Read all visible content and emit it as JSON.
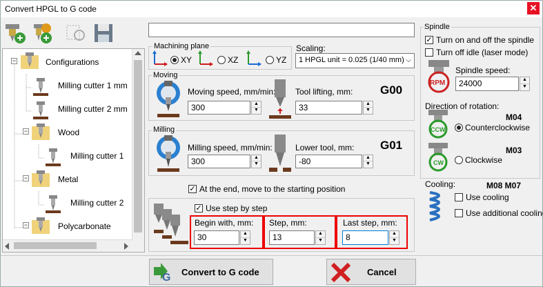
{
  "window": {
    "title": "Convert HPGL to G code",
    "close_glyph": "✕"
  },
  "toolbar": {
    "buttons": [
      "add-config-icon",
      "add-tool-icon",
      "copy-icon",
      "save-icon"
    ]
  },
  "tree": {
    "items": [
      {
        "label": "Configurations",
        "expander": "−"
      },
      {
        "label": "Milling cutter 1 mm"
      },
      {
        "label": "Milling cutter 2 mm"
      },
      {
        "label": "Wood",
        "expander": "−"
      },
      {
        "label": "Milling cutter 1"
      },
      {
        "label": "Metal",
        "expander": "−"
      },
      {
        "label": "Milling cutter 2"
      },
      {
        "label": "Polycarbonate",
        "expander": "−"
      }
    ]
  },
  "name_field": {
    "value": ""
  },
  "machining_plane": {
    "label": "Machining plane",
    "options": [
      {
        "label": "XY",
        "checked": true
      },
      {
        "label": "XZ",
        "checked": false
      },
      {
        "label": "YZ",
        "checked": false
      }
    ]
  },
  "scaling": {
    "label": "Scaling:",
    "value": "1 HPGL unit = 0.025 (1/40 mm)"
  },
  "moving": {
    "group_label": "Moving",
    "speed_label": "Moving speed, mm/min:",
    "speed_value": "300",
    "lift_label": "Tool lifting, mm:",
    "lift_value": "33",
    "code": "G00"
  },
  "milling": {
    "group_label": "Milling",
    "speed_label": "Milling speed, mm/min:",
    "speed_value": "300",
    "lower_label": "Lower tool, mm:",
    "lower_value": "-80",
    "code": "G01"
  },
  "return_start": {
    "label": "At the end, move to the starting position",
    "checked": true
  },
  "step": {
    "use_label": "Use step by step",
    "checked": true,
    "begin_label": "Begin with, mm:",
    "begin_value": "30",
    "step_label": "Step, mm:",
    "step_value": "13",
    "last_label": "Last step, mm:",
    "last_value": "8"
  },
  "spindle": {
    "group_label": "Spindle",
    "turn_on_off": {
      "label": "Turn on and off the spindle",
      "checked": true
    },
    "turn_off_idle": {
      "label": "Turn off idle (laser mode)",
      "checked": false
    },
    "speed_label": "Spindle speed:",
    "speed_value": "24000",
    "rpm_text": "RPM",
    "direction_label": "Direction of rotation:",
    "ccw_code": "M04",
    "ccw_icon_text": "CCW",
    "ccw_label": "Counterclockwise",
    "ccw_checked": true,
    "cw_code": "M03",
    "cw_icon_text": "CW",
    "cw_label": "Clockwise",
    "cw_checked": false
  },
  "cooling": {
    "label": "Cooling:",
    "codes": "M08 M07",
    "use_cooling": {
      "label": "Use cooling",
      "checked": false
    },
    "use_additional": {
      "label": "Use additional cooling",
      "checked": false
    }
  },
  "actions": {
    "convert_label": "Convert to G code",
    "cancel_label": "Cancel"
  },
  "colors": {
    "highlight_red": "#e00000",
    "close_red": "#e81123",
    "spindle_red": "#cc2222",
    "spindle_green": "#2a9a2a"
  }
}
